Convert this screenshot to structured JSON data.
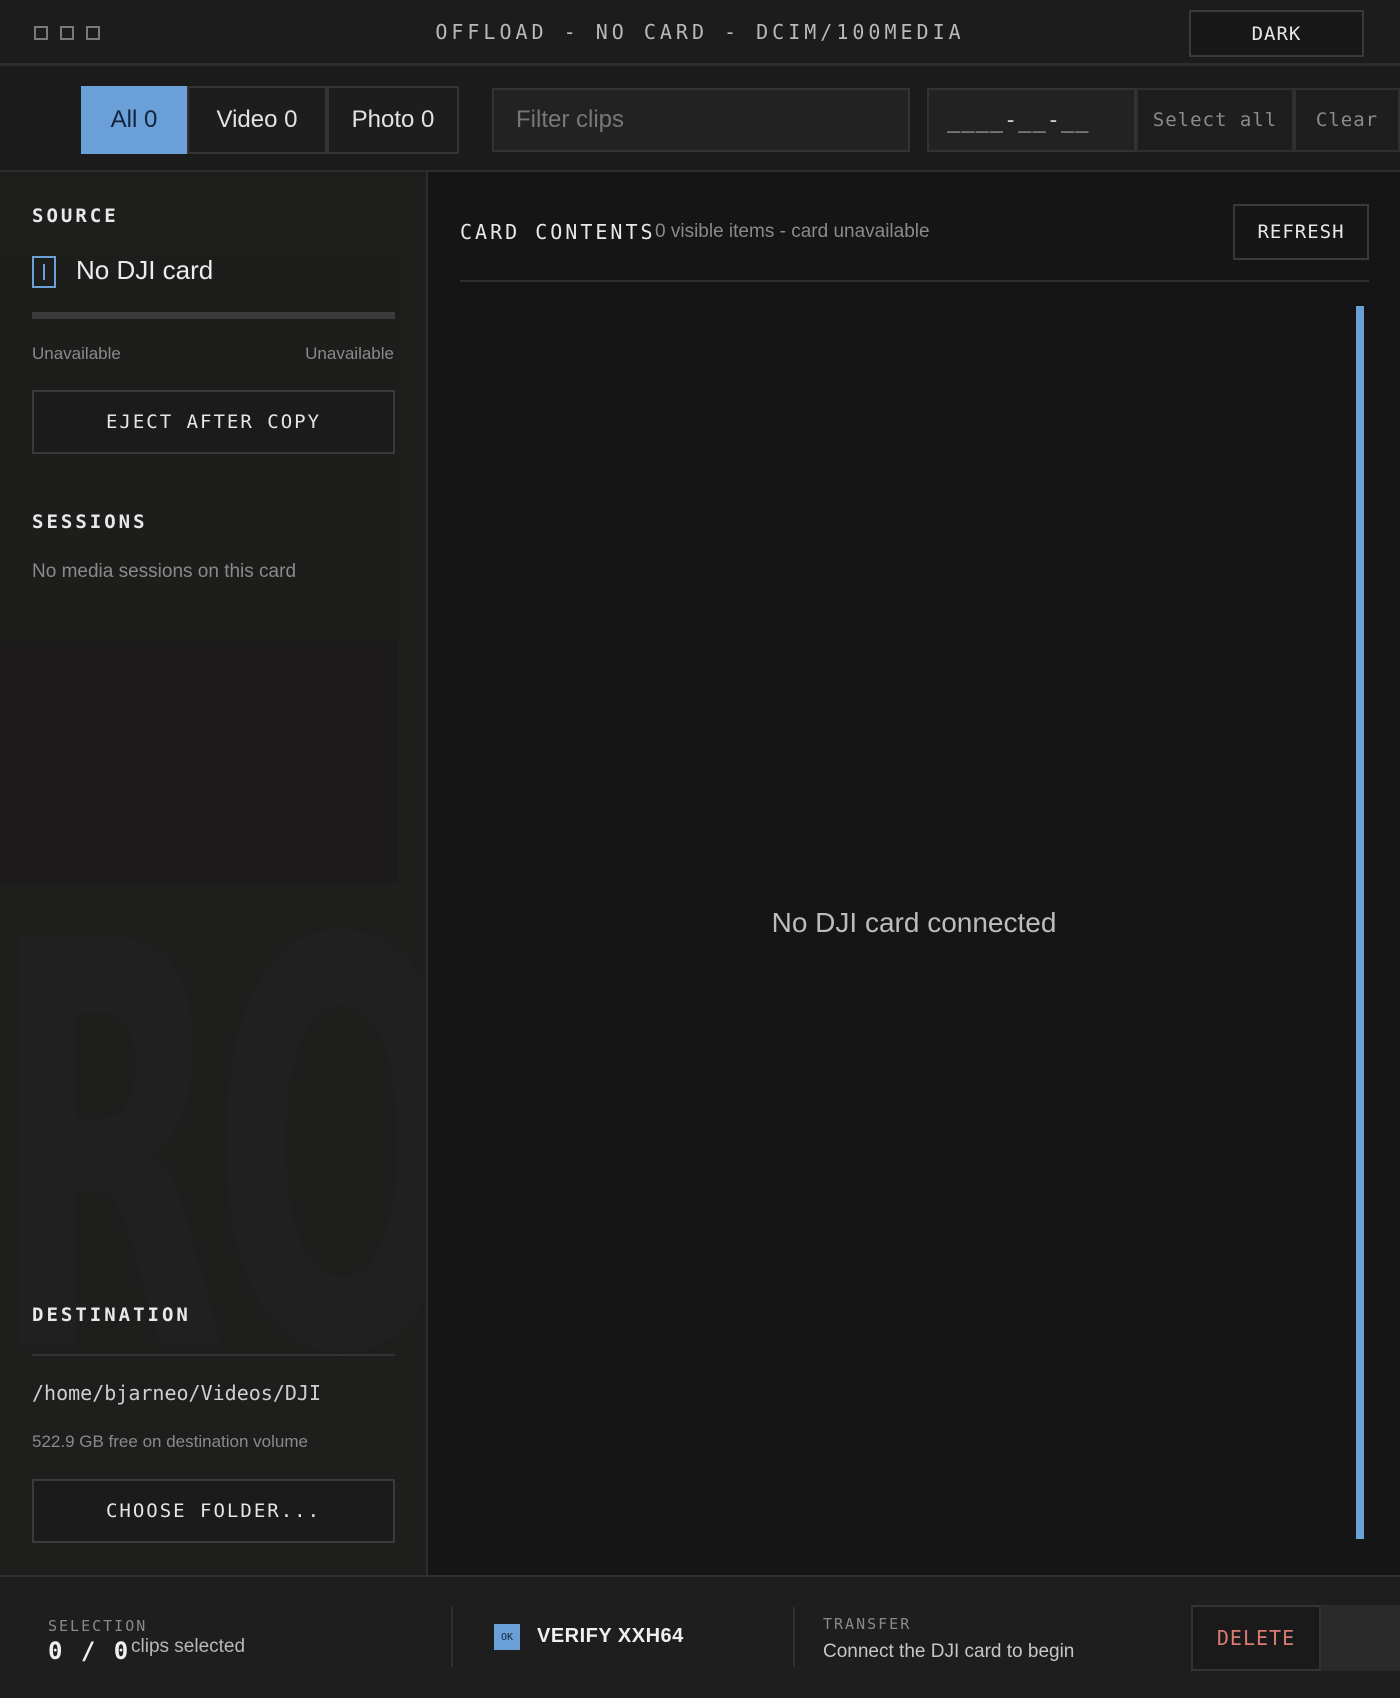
{
  "titlebar": {
    "title": "OFFLOAD - NO CARD - DCIM/100MEDIA",
    "theme_button": "DARK"
  },
  "toolbar": {
    "tabs": [
      {
        "label": "All 0",
        "active": true
      },
      {
        "label": "Video 0",
        "active": false
      },
      {
        "label": "Photo 0",
        "active": false
      }
    ],
    "filter_placeholder": "Filter clips",
    "date_value": "____-__-__",
    "select_all": "Select all",
    "clear": "Clear"
  },
  "sidebar": {
    "source": {
      "heading": "SOURCE",
      "card_name": "No DJI card",
      "capacity_used": 0,
      "left_label": "Unavailable",
      "right_label": "Unavailable",
      "eject_button": "EJECT AFTER COPY"
    },
    "sessions": {
      "heading": "SESSIONS",
      "empty_text": "No media sessions on this card"
    },
    "destination": {
      "heading": "DESTINATION",
      "path": "/home/bjarneo/Videos/DJI",
      "free_space": "522.9 GB free on destination volume",
      "choose_button": "CHOOSE FOLDER..."
    },
    "watermark": "ROID"
  },
  "main": {
    "heading": "CARD CONTENTS",
    "subtitle": "0 visible items - card unavailable",
    "refresh_button": "REFRESH",
    "empty_message": "No DJI card connected"
  },
  "footer": {
    "selection_label": "SELECTION",
    "selection_count": "0 / 0",
    "selection_unit": "clips selected",
    "verify_badge": "OK",
    "verify_label": "VERIFY XXH64",
    "transfer_label": "TRANSFER",
    "transfer_text": "Connect the DJI card to begin",
    "delete_button": "DELETE"
  },
  "colors": {
    "accent": "#6a9fd8",
    "danger": "#d97a73",
    "background": "#161616"
  },
  "icons": [
    "window-control-icon",
    "sd-card-icon",
    "verify-ok-icon"
  ]
}
